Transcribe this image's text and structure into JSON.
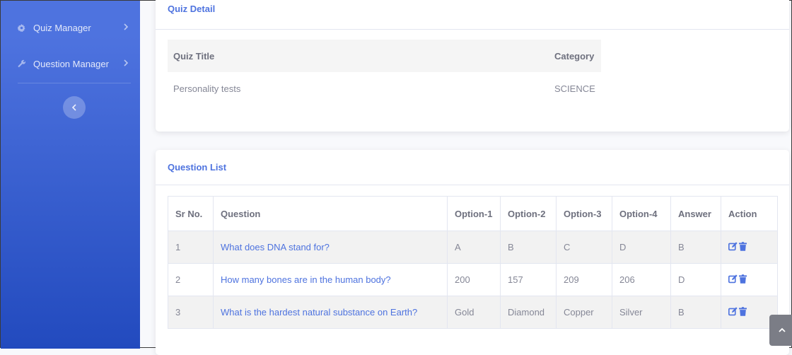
{
  "sidebar": {
    "items": [
      {
        "label": "Quiz Manager",
        "icon": "cog-icon"
      },
      {
        "label": "Question Manager",
        "icon": "wrench-icon"
      }
    ]
  },
  "quiz_detail": {
    "title": "Quiz Detail",
    "columns": [
      "Quiz Title",
      "Category"
    ],
    "row": {
      "quiz_title": "Personality tests",
      "category": "SCIENCE"
    }
  },
  "question_list": {
    "title": "Question List",
    "columns": [
      "Sr No.",
      "Question",
      "Option-1",
      "Option-2",
      "Option-3",
      "Option-4",
      "Answer",
      "Action"
    ],
    "rows": [
      {
        "sr": "1",
        "question": "What does DNA stand for?",
        "opt1": "A",
        "opt2": "B",
        "opt3": "C",
        "opt4": "D",
        "answer": "B"
      },
      {
        "sr": "2",
        "question": "How many bones are in the human body?",
        "opt1": "200",
        "opt2": "157",
        "opt3": "209",
        "opt4": "206",
        "answer": "D"
      },
      {
        "sr": "3",
        "question": "What is the hardest natural substance on Earth?",
        "opt1": "Gold",
        "opt2": "Diamond",
        "opt3": "Copper",
        "opt4": "Silver",
        "answer": "B"
      }
    ]
  },
  "colors": {
    "primary": "#4e73df",
    "sidebar_dark": "#224abe"
  }
}
